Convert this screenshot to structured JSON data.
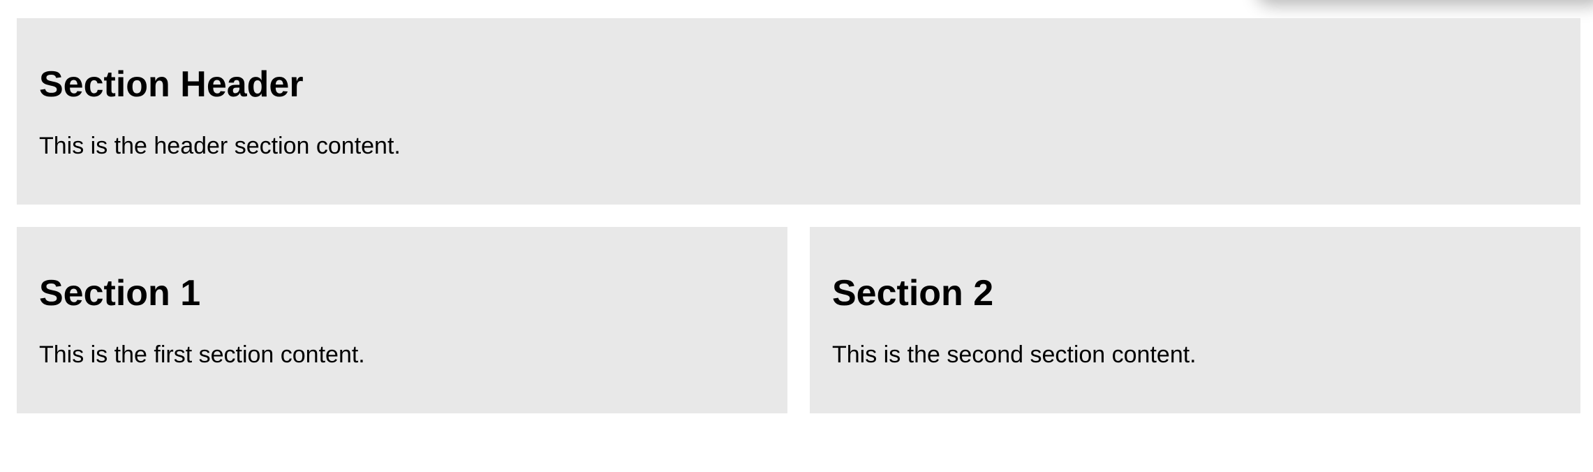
{
  "sections": {
    "header": {
      "title": "Section Header",
      "content": "This is the header section content."
    },
    "section1": {
      "title": "Section 1",
      "content": "This is the first section content."
    },
    "section2": {
      "title": "Section 2",
      "content": "This is the second section content."
    }
  },
  "colors": {
    "panel_background": "#e8e8e8",
    "page_background": "#ffffff",
    "text": "#000000"
  }
}
